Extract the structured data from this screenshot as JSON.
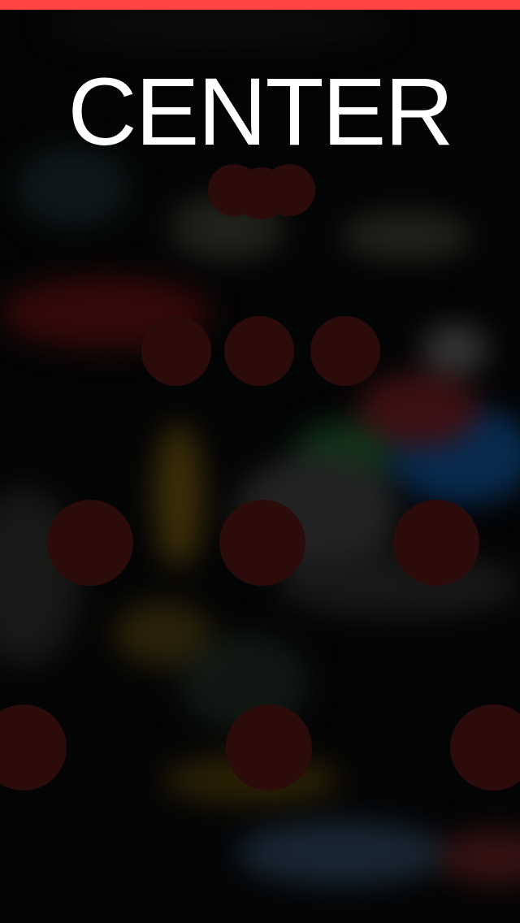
{
  "screen": {
    "title": "CENTER"
  },
  "colors": {
    "top_bar": "#ff4444",
    "dot": "#2c0b0b",
    "title_text": "#ffffff"
  },
  "dot_grid": {
    "rows": [
      {
        "count": 3,
        "size": "small"
      },
      {
        "count": 3,
        "size": "medium"
      },
      {
        "count": 3,
        "size": "large"
      },
      {
        "count": 3,
        "size": "large"
      }
    ]
  }
}
